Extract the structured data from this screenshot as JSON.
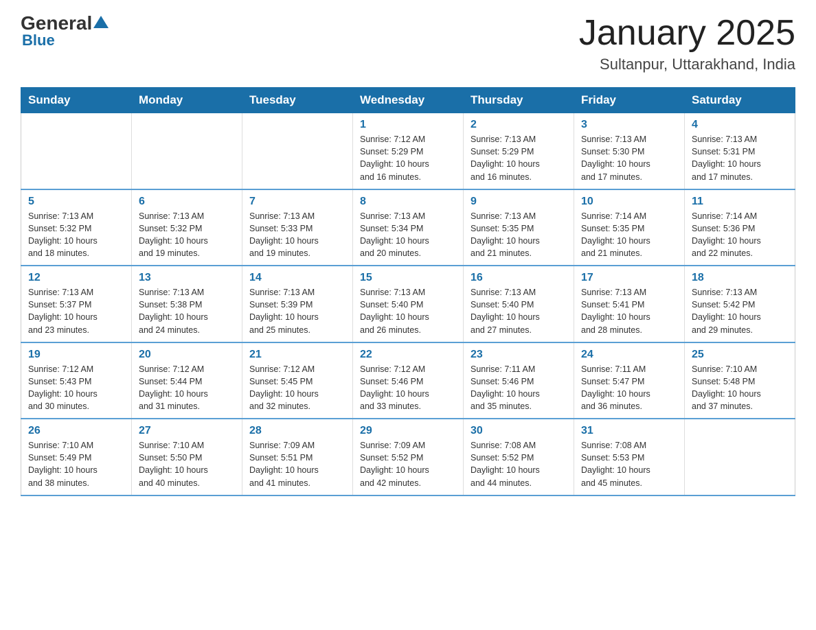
{
  "header": {
    "logo_general": "General",
    "logo_blue": "Blue",
    "title": "January 2025",
    "subtitle": "Sultanpur, Uttarakhand, India"
  },
  "days_of_week": [
    "Sunday",
    "Monday",
    "Tuesday",
    "Wednesday",
    "Thursday",
    "Friday",
    "Saturday"
  ],
  "weeks": [
    [
      {
        "day": "",
        "info": ""
      },
      {
        "day": "",
        "info": ""
      },
      {
        "day": "",
        "info": ""
      },
      {
        "day": "1",
        "info": "Sunrise: 7:12 AM\nSunset: 5:29 PM\nDaylight: 10 hours\nand 16 minutes."
      },
      {
        "day": "2",
        "info": "Sunrise: 7:13 AM\nSunset: 5:29 PM\nDaylight: 10 hours\nand 16 minutes."
      },
      {
        "day": "3",
        "info": "Sunrise: 7:13 AM\nSunset: 5:30 PM\nDaylight: 10 hours\nand 17 minutes."
      },
      {
        "day": "4",
        "info": "Sunrise: 7:13 AM\nSunset: 5:31 PM\nDaylight: 10 hours\nand 17 minutes."
      }
    ],
    [
      {
        "day": "5",
        "info": "Sunrise: 7:13 AM\nSunset: 5:32 PM\nDaylight: 10 hours\nand 18 minutes."
      },
      {
        "day": "6",
        "info": "Sunrise: 7:13 AM\nSunset: 5:32 PM\nDaylight: 10 hours\nand 19 minutes."
      },
      {
        "day": "7",
        "info": "Sunrise: 7:13 AM\nSunset: 5:33 PM\nDaylight: 10 hours\nand 19 minutes."
      },
      {
        "day": "8",
        "info": "Sunrise: 7:13 AM\nSunset: 5:34 PM\nDaylight: 10 hours\nand 20 minutes."
      },
      {
        "day": "9",
        "info": "Sunrise: 7:13 AM\nSunset: 5:35 PM\nDaylight: 10 hours\nand 21 minutes."
      },
      {
        "day": "10",
        "info": "Sunrise: 7:14 AM\nSunset: 5:35 PM\nDaylight: 10 hours\nand 21 minutes."
      },
      {
        "day": "11",
        "info": "Sunrise: 7:14 AM\nSunset: 5:36 PM\nDaylight: 10 hours\nand 22 minutes."
      }
    ],
    [
      {
        "day": "12",
        "info": "Sunrise: 7:13 AM\nSunset: 5:37 PM\nDaylight: 10 hours\nand 23 minutes."
      },
      {
        "day": "13",
        "info": "Sunrise: 7:13 AM\nSunset: 5:38 PM\nDaylight: 10 hours\nand 24 minutes."
      },
      {
        "day": "14",
        "info": "Sunrise: 7:13 AM\nSunset: 5:39 PM\nDaylight: 10 hours\nand 25 minutes."
      },
      {
        "day": "15",
        "info": "Sunrise: 7:13 AM\nSunset: 5:40 PM\nDaylight: 10 hours\nand 26 minutes."
      },
      {
        "day": "16",
        "info": "Sunrise: 7:13 AM\nSunset: 5:40 PM\nDaylight: 10 hours\nand 27 minutes."
      },
      {
        "day": "17",
        "info": "Sunrise: 7:13 AM\nSunset: 5:41 PM\nDaylight: 10 hours\nand 28 minutes."
      },
      {
        "day": "18",
        "info": "Sunrise: 7:13 AM\nSunset: 5:42 PM\nDaylight: 10 hours\nand 29 minutes."
      }
    ],
    [
      {
        "day": "19",
        "info": "Sunrise: 7:12 AM\nSunset: 5:43 PM\nDaylight: 10 hours\nand 30 minutes."
      },
      {
        "day": "20",
        "info": "Sunrise: 7:12 AM\nSunset: 5:44 PM\nDaylight: 10 hours\nand 31 minutes."
      },
      {
        "day": "21",
        "info": "Sunrise: 7:12 AM\nSunset: 5:45 PM\nDaylight: 10 hours\nand 32 minutes."
      },
      {
        "day": "22",
        "info": "Sunrise: 7:12 AM\nSunset: 5:46 PM\nDaylight: 10 hours\nand 33 minutes."
      },
      {
        "day": "23",
        "info": "Sunrise: 7:11 AM\nSunset: 5:46 PM\nDaylight: 10 hours\nand 35 minutes."
      },
      {
        "day": "24",
        "info": "Sunrise: 7:11 AM\nSunset: 5:47 PM\nDaylight: 10 hours\nand 36 minutes."
      },
      {
        "day": "25",
        "info": "Sunrise: 7:10 AM\nSunset: 5:48 PM\nDaylight: 10 hours\nand 37 minutes."
      }
    ],
    [
      {
        "day": "26",
        "info": "Sunrise: 7:10 AM\nSunset: 5:49 PM\nDaylight: 10 hours\nand 38 minutes."
      },
      {
        "day": "27",
        "info": "Sunrise: 7:10 AM\nSunset: 5:50 PM\nDaylight: 10 hours\nand 40 minutes."
      },
      {
        "day": "28",
        "info": "Sunrise: 7:09 AM\nSunset: 5:51 PM\nDaylight: 10 hours\nand 41 minutes."
      },
      {
        "day": "29",
        "info": "Sunrise: 7:09 AM\nSunset: 5:52 PM\nDaylight: 10 hours\nand 42 minutes."
      },
      {
        "day": "30",
        "info": "Sunrise: 7:08 AM\nSunset: 5:52 PM\nDaylight: 10 hours\nand 44 minutes."
      },
      {
        "day": "31",
        "info": "Sunrise: 7:08 AM\nSunset: 5:53 PM\nDaylight: 10 hours\nand 45 minutes."
      },
      {
        "day": "",
        "info": ""
      }
    ]
  ]
}
